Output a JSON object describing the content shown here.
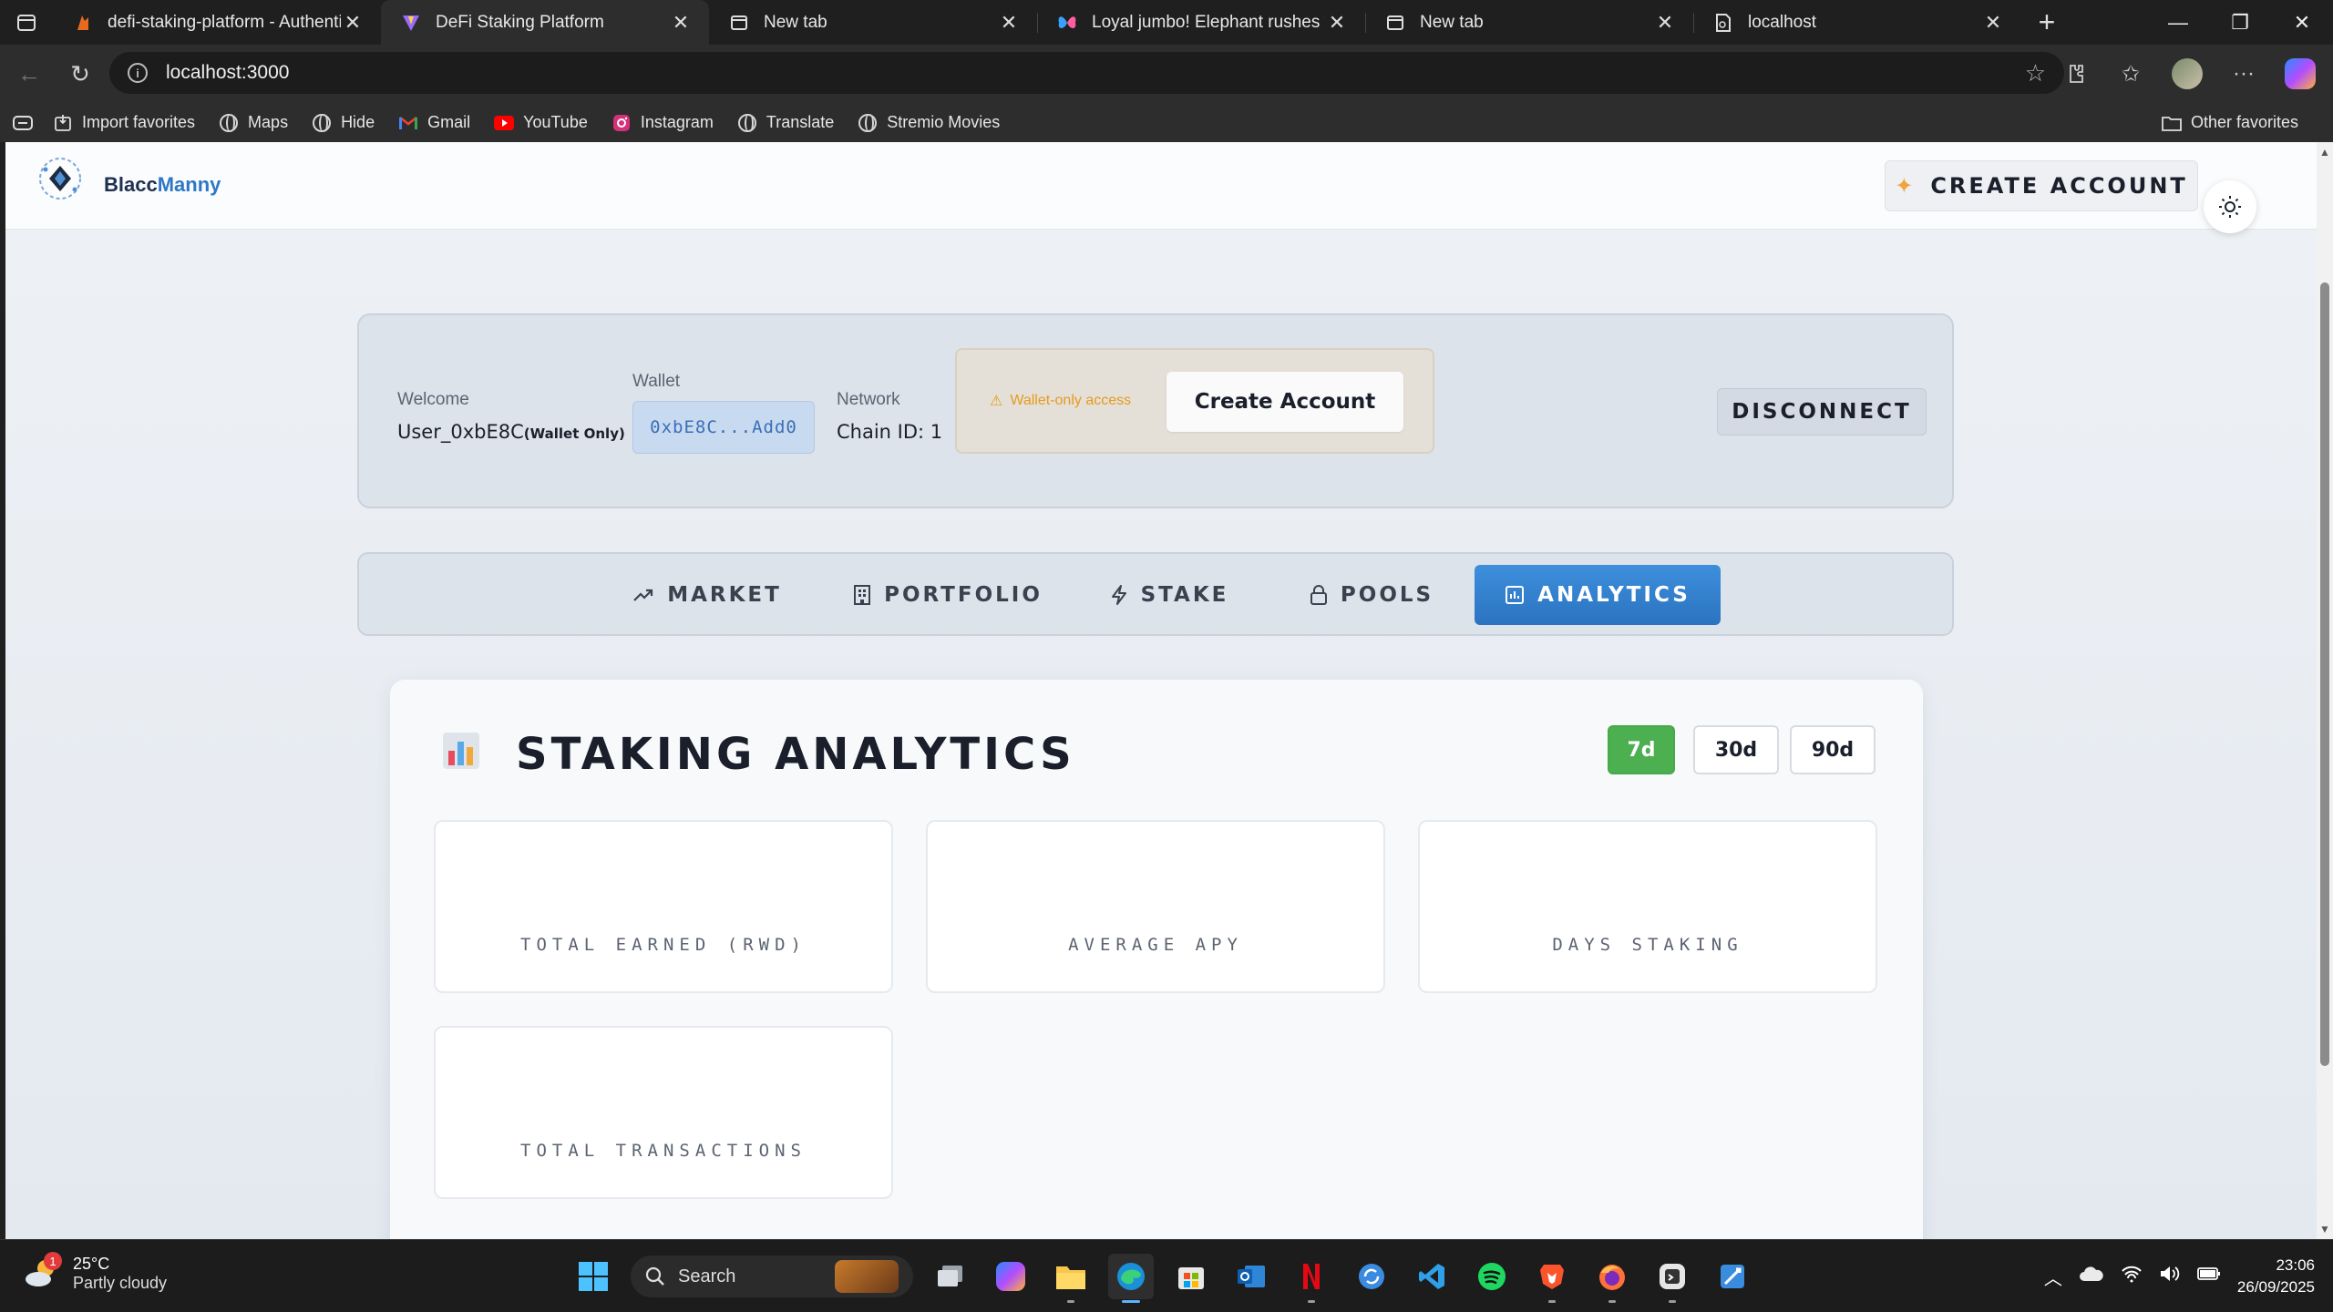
{
  "browser": {
    "tabs": [
      {
        "title": "defi-staking-platform - Authentic",
        "active": false
      },
      {
        "title": "DeFi Staking Platform",
        "active": true
      },
      {
        "title": "New tab",
        "active": false
      },
      {
        "title": "Loyal jumbo! Elephant rushes to s",
        "active": false
      },
      {
        "title": "New tab",
        "active": false
      },
      {
        "title": "localhost",
        "active": false
      }
    ],
    "url": "localhost:3000",
    "favorites": [
      "Import favorites",
      "Maps",
      "Hide",
      "Gmail",
      "YouTube",
      "Instagram",
      "Translate",
      "Stremio Movies"
    ],
    "other_favorites": "Other favorites"
  },
  "app": {
    "brand_prefix": "Blacc",
    "brand_suffix": "Manny",
    "create_account_top": "CREATE ACCOUNT",
    "wallet": {
      "welcome_label": "Welcome",
      "welcome_user": "User_0xbE8C",
      "wallet_only_tag": "(Wallet Only)",
      "wallet_label": "Wallet",
      "wallet_address": "0xbE8C...Add0",
      "network_label": "Network",
      "network_value": "Chain ID: 1",
      "warning": "Wallet-only access",
      "create_account": "Create Account",
      "disconnect": "DISCONNECT"
    },
    "nav_tabs": [
      {
        "label": "MARKET",
        "icon": "trending-up-icon",
        "active": false
      },
      {
        "label": "PORTFOLIO",
        "icon": "building-icon",
        "active": false
      },
      {
        "label": "STAKE",
        "icon": "bolt-icon",
        "active": false
      },
      {
        "label": "POOLS",
        "icon": "lock-icon",
        "active": false
      },
      {
        "label": "ANALYTICS",
        "icon": "bar-chart-icon",
        "active": true
      }
    ],
    "analytics": {
      "title": "STAKING ANALYTICS",
      "ranges": [
        {
          "label": "7d",
          "active": true
        },
        {
          "label": "30d",
          "active": false
        },
        {
          "label": "90d",
          "active": false
        }
      ],
      "stats": [
        {
          "label": "TOTAL EARNED (RWD)",
          "value": ""
        },
        {
          "label": "AVERAGE APY",
          "value": ""
        },
        {
          "label": "DAYS STAKING",
          "value": ""
        },
        {
          "label": "TOTAL TRANSACTIONS",
          "value": ""
        }
      ]
    }
  },
  "taskbar": {
    "weather_temp": "25°C",
    "weather_desc": "Partly cloudy",
    "weather_badge": "1",
    "search_label": "Search",
    "time": "23:06",
    "date": "26/09/2025"
  },
  "colors": {
    "accent_blue": "#2b73c0",
    "active_green": "#4caf50",
    "warning_orange": "#e59a1e"
  }
}
